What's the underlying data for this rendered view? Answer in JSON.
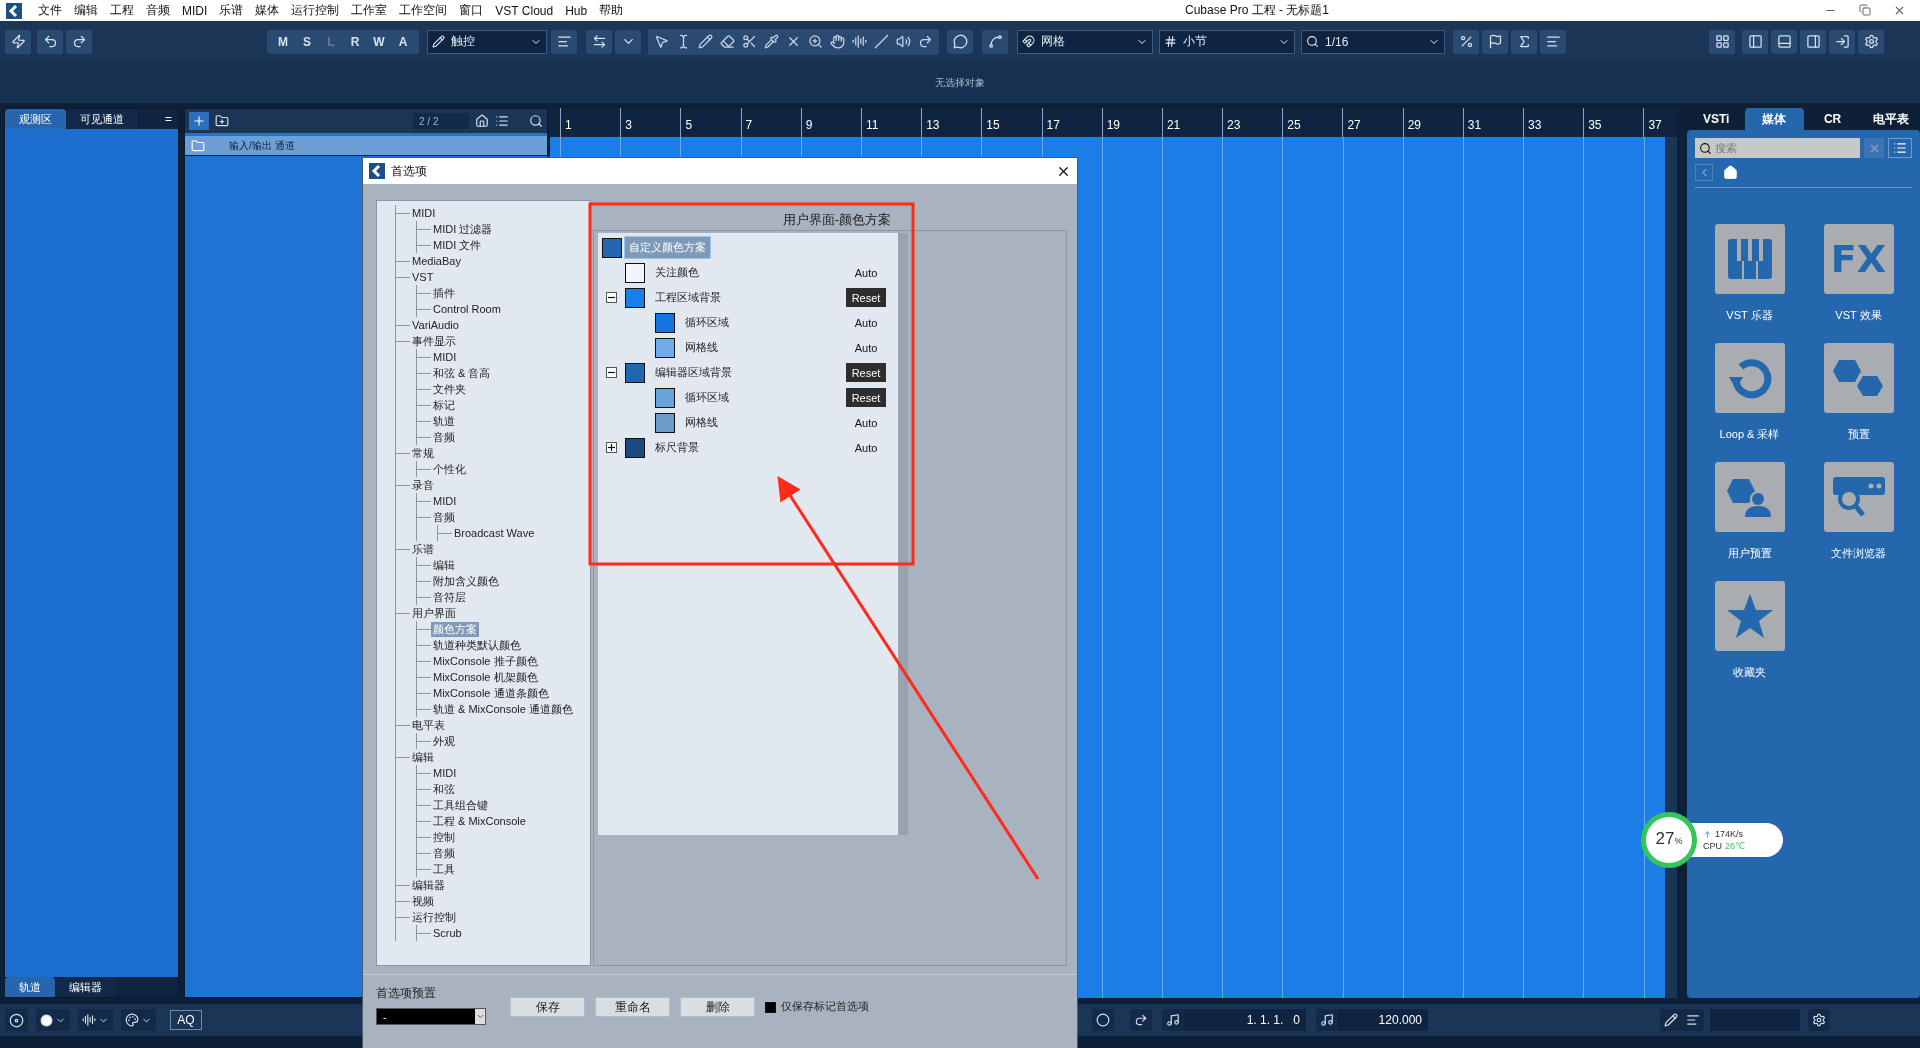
{
  "title_bar": {
    "title": "Cubase Pro 工程 - 无标题1",
    "menus": [
      "文件",
      "编辑",
      "工程",
      "音频",
      "MIDI",
      "乐谱",
      "媒体",
      "运行控制",
      "工作室",
      "工作空间",
      "窗口",
      "VST Cloud",
      "Hub",
      "帮助"
    ]
  },
  "toolbar": {
    "mode_buttons": [
      {
        "label": "M",
        "disabled": false
      },
      {
        "label": "S",
        "disabled": false
      },
      {
        "label": "L",
        "disabled": true
      },
      {
        "label": "R",
        "disabled": false
      },
      {
        "label": "W",
        "disabled": false
      },
      {
        "label": "A",
        "disabled": false
      }
    ],
    "touch_mode": "触控",
    "snap_type": "网格",
    "grid_type": "小节",
    "quantize": "1/16"
  },
  "info_line": "无选择对象",
  "zone_tabs": [
    {
      "label": "观测区",
      "selected": true
    },
    {
      "label": "可见通道",
      "selected": false
    }
  ],
  "zone_menu": "=",
  "zone_bottom_tabs": [
    {
      "label": "轨道",
      "selected": true
    },
    {
      "label": "编辑器",
      "selected": false
    }
  ],
  "track_list": {
    "count": "2 / 2",
    "tracks": [
      {
        "name": "输入/输出 通道"
      }
    ]
  },
  "ruler": {
    "bars": [
      "1",
      "3",
      "5",
      "7",
      "9",
      "11",
      "13",
      "15",
      "17",
      "19",
      "21",
      "23",
      "25",
      "27",
      "29",
      "31",
      "33",
      "35",
      "37"
    ]
  },
  "media_panel": {
    "effects_logo": "FX",
    "tabs": [
      {
        "label": "VSTi",
        "selected": false
      },
      {
        "label": "媒体",
        "selected": true
      },
      {
        "label": "CR",
        "selected": false
      },
      {
        "label": "电平表",
        "selected": false
      }
    ],
    "search": {
      "placeholder": "搜索"
    },
    "tiles": [
      {
        "kind": "piano",
        "label": "VST 乐器"
      },
      {
        "kind": "fx",
        "label": "VST 效果"
      },
      {
        "kind": "loop",
        "label": "Loop & 采样"
      },
      {
        "kind": "presets",
        "label": "预置"
      },
      {
        "kind": "user-presets",
        "label": "用户预置"
      },
      {
        "kind": "file-browser",
        "label": "文件浏览器"
      },
      {
        "kind": "favorites",
        "label": "收藏夹"
      }
    ]
  },
  "transport": {
    "quantize_button": "AQ",
    "position": "1. 1. 1.   0",
    "tempo": "120.000"
  },
  "preferences_dialog": {
    "title": "首选项",
    "tree": [
      {
        "label": "MIDI",
        "selected": false,
        "children": [
          {
            "label": "MIDI 过滤器",
            "selected": false
          },
          {
            "label": "MIDI 文件",
            "selected": false
          }
        ]
      },
      {
        "label": "MediaBay",
        "selected": false
      },
      {
        "label": "VST",
        "selected": false,
        "children": [
          {
            "label": "插件",
            "selected": false
          },
          {
            "label": "Control Room",
            "selected": false
          }
        ]
      },
      {
        "label": "VariAudio",
        "selected": false
      },
      {
        "label": "事件显示",
        "selected": false,
        "children": [
          {
            "label": "MIDI",
            "selected": false
          },
          {
            "label": "和弦 & 音高",
            "selected": false
          },
          {
            "label": "文件夹",
            "selected": false
          },
          {
            "label": "标记",
            "selected": false
          },
          {
            "label": "轨道",
            "selected": false
          },
          {
            "label": "音频",
            "selected": false
          }
        ]
      },
      {
        "label": "常规",
        "selected": false,
        "children": [
          {
            "label": "个性化",
            "selected": false
          }
        ]
      },
      {
        "label": "录音",
        "selected": false,
        "children": [
          {
            "label": "MIDI",
            "selected": false
          },
          {
            "label": "音频",
            "selected": false,
            "children": [
              {
                "label": "Broadcast Wave",
                "selected": false
              }
            ]
          }
        ]
      },
      {
        "label": "乐谱",
        "selected": false,
        "children": [
          {
            "label": "编辑",
            "selected": false
          },
          {
            "label": "附加含义颜色",
            "selected": false
          },
          {
            "label": "音符层",
            "selected": false
          }
        ]
      },
      {
        "label": "用户界面",
        "selected": false,
        "children": [
          {
            "label": "颜色方案",
            "selected": true
          },
          {
            "label": "轨道种类默认颜色",
            "selected": false
          },
          {
            "label": "MixConsole 推子颜色",
            "selected": false
          },
          {
            "label": "MixConsole 机架颜色",
            "selected": false
          },
          {
            "label": "MixConsole 通道条颜色",
            "selected": false
          },
          {
            "label": "轨道 & MixConsole 通道颜色",
            "selected": false
          }
        ]
      },
      {
        "label": "电平表",
        "selected": false,
        "children": [
          {
            "label": "外观",
            "selected": false
          }
        ]
      },
      {
        "label": "编辑",
        "selected": false,
        "children": [
          {
            "label": "MIDI",
            "selected": false
          },
          {
            "label": "和弦",
            "selected": false
          },
          {
            "label": "工具组合键",
            "selected": false
          },
          {
            "label": "工程 & MixConsole",
            "selected": false
          },
          {
            "label": "控制",
            "selected": false
          },
          {
            "label": "音频",
            "selected": false
          },
          {
            "label": "工具",
            "selected": false
          }
        ]
      },
      {
        "label": "编辑器",
        "selected": false
      },
      {
        "label": "视频",
        "selected": false
      },
      {
        "label": "运行控制",
        "selected": false,
        "children": [
          {
            "label": "Scrub",
            "selected": false
          }
        ]
      }
    ],
    "page_title": "用户界面-颜色方案",
    "color_scheme": {
      "root": {
        "label": "自定义颜色方案",
        "color": "#2466b0",
        "selected": true
      },
      "items": [
        {
          "label": "关注颜色",
          "color": "#f2f5fa",
          "action": {
            "kind": "text",
            "label": "Auto"
          }
        },
        {
          "label": "工程区域背景",
          "color": "#1a7ee6",
          "expanded": true,
          "action": {
            "kind": "button",
            "label": "Reset"
          },
          "children": [
            {
              "label": "循环区域",
              "color": "#1474e0",
              "action": {
                "kind": "text",
                "label": "Auto"
              }
            },
            {
              "label": "网格线",
              "color": "#70aaea",
              "action": {
                "kind": "text",
                "label": "Auto"
              }
            }
          ]
        },
        {
          "label": "编辑器区域背景",
          "color": "#2266b0",
          "expanded": true,
          "action": {
            "kind": "button",
            "label": "Reset"
          },
          "children": [
            {
              "label": "循环区域",
              "color": "#6aa2dc",
              "action": {
                "kind": "button",
                "label": "Reset"
              }
            },
            {
              "label": "网格线",
              "color": "#6c9ccc",
              "action": {
                "kind": "text",
                "label": "Auto"
              }
            }
          ]
        },
        {
          "label": "标尺背景",
          "color": "#1a4a80",
          "expanded": false,
          "action": {
            "kind": "text",
            "label": "Auto"
          }
        }
      ]
    },
    "preset_label": "首选项预置",
    "preset_value": "-",
    "buttons": [
      "保存",
      "重命名",
      "删除"
    ],
    "only_marked": {
      "label": "仅保存标记首选项",
      "checked": true
    }
  },
  "system_monitor": {
    "load": "27",
    "unit": "%",
    "speed": "174K/s",
    "cpu_label": "CPU",
    "temperature": "26℃"
  }
}
